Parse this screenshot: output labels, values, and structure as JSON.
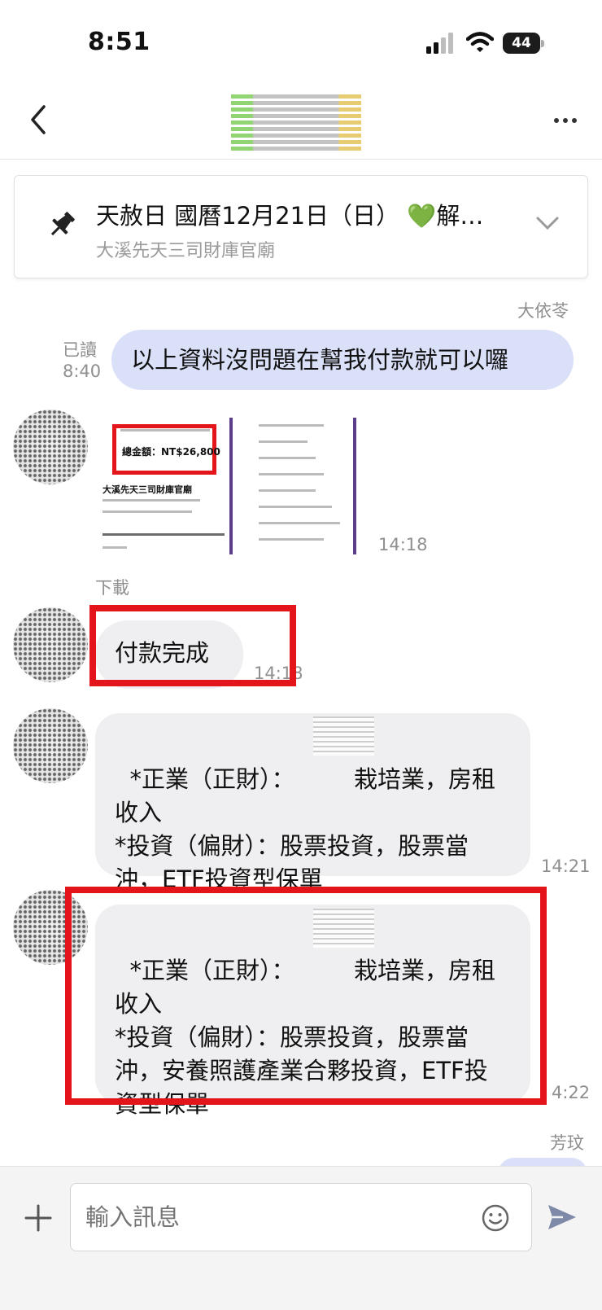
{
  "status_bar": {
    "time": "8:51",
    "battery": "44"
  },
  "header": {
    "back_icon": "chevron-left-icon",
    "more_icon": "ellipsis-icon"
  },
  "pinned": {
    "title": "天赦日 國曆12月21日（日） 💚解…",
    "subtitle": "大溪先天三司財庫官廟"
  },
  "messages": {
    "m1": {
      "sender": "大依苓",
      "status": "已讀",
      "time": "8:40",
      "text": "以上資料沒問題在幫我付款就可以囉"
    },
    "m2": {
      "time": "14:18",
      "download": "下載",
      "image_total": "總金額：NT$26,800",
      "image_temple": "大溪先天三司財庫官廟"
    },
    "m3": {
      "text": "付款完成",
      "time": "14:18"
    },
    "m4": {
      "text": "*正業（正財）：　　　栽培業，房租收入\n*投資（偏財）：股票投資，股票當沖，ETF投資型保單",
      "time": "14:21"
    },
    "m5": {
      "text": "*正業（正財）：　　　栽培業，房租收入\n*投資（偏財）：股票投資，股票當沖，安養照護產業合夥投資，ETF投資型保單",
      "time": "4:22"
    },
    "m6": {
      "sender": "芳玟"
    }
  },
  "input": {
    "placeholder": "輸入訊息"
  },
  "colors": {
    "outgoing_bubble": "#d9e0f8",
    "incoming_bubble": "#efeff1",
    "highlight_red": "#e4141b"
  }
}
